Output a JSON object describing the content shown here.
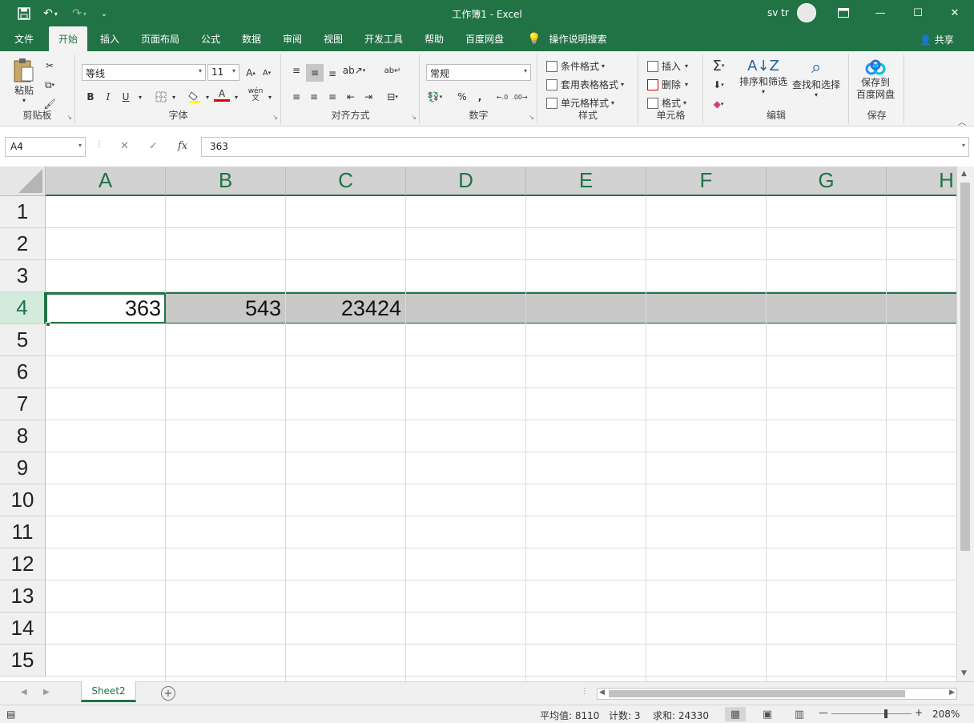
{
  "title_bar": {
    "title": "工作簿1 - Excel",
    "user": "sv tr",
    "save_icon": "save-icon",
    "undo_icon": "undo-icon",
    "redo_icon": "redo-icon",
    "customize_icon": "customize-qat-icon",
    "ribbon_display_icon": "ribbon-display-icon",
    "minimize": "—",
    "maximize": "☐",
    "close": "✕",
    "accent_color": "#217346"
  },
  "tabs": {
    "items": [
      "文件",
      "开始",
      "插入",
      "页面布局",
      "公式",
      "数据",
      "审阅",
      "视图",
      "开发工具",
      "帮助",
      "百度网盘"
    ],
    "active": "开始",
    "tell_me": "操作说明搜索",
    "share": "共享"
  },
  "ribbon": {
    "clipboard": {
      "paste": "粘贴",
      "label": "剪贴板"
    },
    "font": {
      "font_name": "等线",
      "font_size": "11",
      "bold": "B",
      "italic": "I",
      "underline": "U",
      "font_color_letter": "A",
      "phonetic": "wén",
      "label": "字体"
    },
    "alignment": {
      "label": "对齐方式"
    },
    "number": {
      "format": "常规",
      "percent": "%",
      "comma": ",",
      "label": "数字"
    },
    "styles": {
      "conditional": "条件格式",
      "table": "套用表格格式",
      "cell_styles": "单元格样式",
      "label": "样式"
    },
    "cells": {
      "insert": "插入",
      "delete": "删除",
      "format": "格式",
      "label": "单元格"
    },
    "editing": {
      "sort_filter": "排序和筛选",
      "find_select": "查找和选择",
      "label": "编辑"
    },
    "save": {
      "button": "保存到百度网盘",
      "line1": "保存到",
      "line2": "百度网盘",
      "label": "保存"
    }
  },
  "formula_bar": {
    "name_box": "A4",
    "formula": "363",
    "cancel": "✕",
    "enter": "✓",
    "fx": "fx"
  },
  "grid": {
    "columns": [
      "A",
      "B",
      "C",
      "D",
      "E",
      "F",
      "G",
      "H"
    ],
    "rows": [
      "1",
      "2",
      "3",
      "4",
      "5",
      "6",
      "7",
      "8",
      "9",
      "10",
      "11",
      "12",
      "13",
      "14",
      "15"
    ],
    "selected_row": "4",
    "cells": {
      "A4": "363",
      "B4": "543",
      "C4": "23424"
    }
  },
  "sheets": {
    "tabs": [
      "Sheet2"
    ],
    "active": "Sheet2",
    "add_icon": "add-sheet-icon"
  },
  "status_bar": {
    "average": "平均值: 8110",
    "count": "计数: 3",
    "sum": "求和: 24330",
    "zoom": "208%",
    "zoom_minus": "—",
    "zoom_plus": "+"
  }
}
